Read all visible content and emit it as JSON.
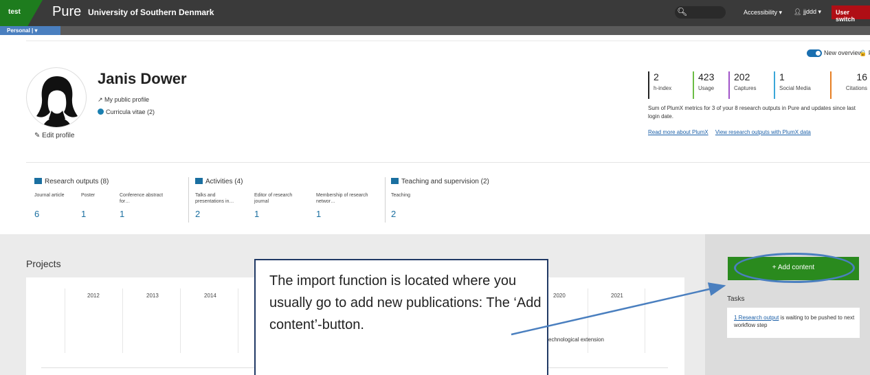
{
  "topbar": {
    "env_label": "test",
    "brand": "Pure",
    "org": "University of Southern Denmark",
    "accessibility": "Accessibility ▾",
    "user": "jjddd ▾",
    "user_switch": "User switch",
    "personal_tab": "Personal | ▾"
  },
  "overview": {
    "new_overview": "New overview",
    "private": "🔒 Privat"
  },
  "profile": {
    "name": "Janis Dower",
    "public_profile": "↗ My public profile",
    "cv": "Curricula vitae (2)",
    "edit": "✎ Edit profile"
  },
  "metrics": [
    {
      "value": "2",
      "label": "h-index",
      "color": "#222222"
    },
    {
      "value": "423",
      "label": "Usage",
      "color": "#6bbd45"
    },
    {
      "value": "202",
      "label": "Captures",
      "color": "#a052c8"
    },
    {
      "value": "1",
      "label": "Social Media",
      "color": "#3aa6d8"
    },
    {
      "value": "16",
      "label": "Citations",
      "color": "#e67e22"
    }
  ],
  "plumx": {
    "note": "Sum of PlumX metrics for 3 of your 8 research outputs in Pure and updates since last login date.",
    "link1": "Read more about PlumX",
    "link2": "View research outputs with PlumX data"
  },
  "groups": {
    "research": {
      "title": "Research outputs (8)",
      "items": [
        {
          "label": "Journal article",
          "count": "6"
        },
        {
          "label": "Poster",
          "count": "1"
        },
        {
          "label": "Conference abstract for…",
          "count": "1"
        }
      ]
    },
    "activities": {
      "title": "Activities (4)",
      "items": [
        {
          "label": "Talks and presentations in…",
          "count": "2"
        },
        {
          "label": "Editor of research journal",
          "count": "1"
        },
        {
          "label": "Membership of research networ…",
          "count": "1"
        }
      ]
    },
    "teaching": {
      "title": "Teaching and supervision (2)",
      "items": [
        {
          "label": "Teaching",
          "count": "2"
        }
      ]
    }
  },
  "projects": {
    "title": "Projects",
    "years": [
      "2012",
      "2013",
      "2014",
      "2020",
      "2021"
    ],
    "project_label": "echnological extension"
  },
  "sidebar": {
    "add_content": "+ Add content",
    "tasks_title": "Tasks",
    "task_link": "1 Research output",
    "task_text": " is waiting to be pushed to next workflow step"
  },
  "callout": {
    "text": "The import function is located where you usually go to add new publications: The ‘Add content’-button."
  },
  "colors": {
    "accent_green": "#2a8a1e",
    "brand_blue": "#4a7fbf",
    "switch_red": "#b00e15"
  }
}
